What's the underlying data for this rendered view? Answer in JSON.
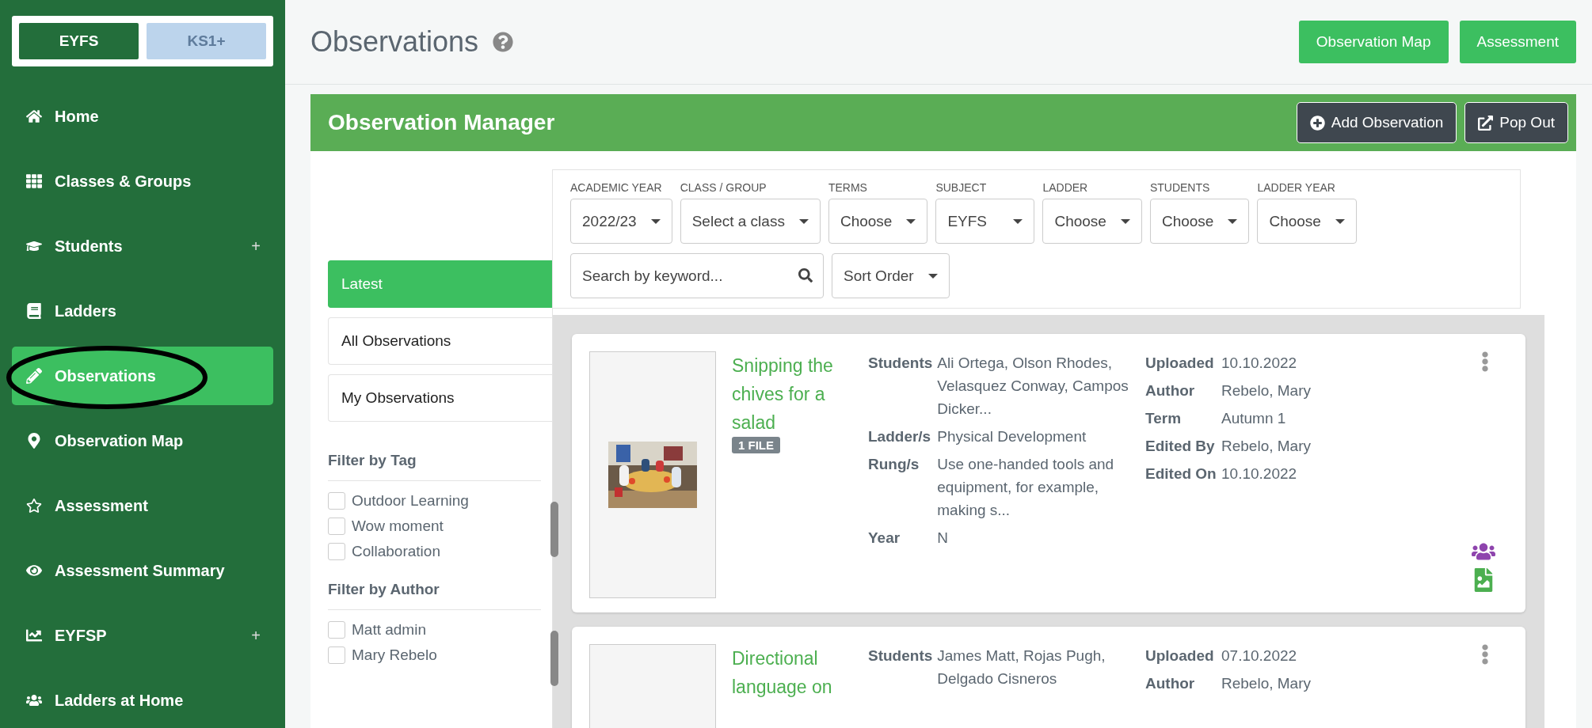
{
  "sidebar": {
    "toggle": [
      {
        "label": "EYFS",
        "selected": true
      },
      {
        "label": "KS1+",
        "selected": false
      }
    ],
    "items": [
      {
        "label": "Home",
        "selected": false
      },
      {
        "label": "Classes & Groups",
        "selected": false
      },
      {
        "label": "Students",
        "selected": false,
        "suffix": "+"
      },
      {
        "label": "Ladders",
        "selected": false
      },
      {
        "label": "Observations",
        "selected": true,
        "circled": true
      },
      {
        "label": "Observation Map",
        "selected": false
      },
      {
        "label": "Assessment",
        "selected": false
      },
      {
        "label": "Assessment Summary",
        "selected": false
      },
      {
        "label": "EYFSP",
        "selected": false,
        "suffix": "+"
      },
      {
        "label": "Ladders at Home",
        "selected": false
      }
    ]
  },
  "header": {
    "title": "Observations",
    "buttons": [
      "Observation Map",
      "Assessment"
    ]
  },
  "panel": {
    "title": "Observation Manager",
    "buttons": [
      "Add Observation",
      "Pop Out"
    ],
    "views": [
      {
        "label": "Latest",
        "selected": true
      },
      {
        "label": "All Observations",
        "selected": false
      },
      {
        "label": "My Observations",
        "selected": false
      }
    ],
    "filter_groups": [
      {
        "title": "Filter by Tag",
        "options": [
          {
            "label": "Outdoor Learning",
            "checked": false
          },
          {
            "label": "Wow moment",
            "checked": false
          },
          {
            "label": "Collaboration",
            "checked": false
          }
        ]
      },
      {
        "title": "Filter by Author",
        "options": [
          {
            "label": "Matt admin",
            "checked": false
          },
          {
            "label": "Mary Rebelo",
            "checked": false
          }
        ]
      }
    ],
    "filters": [
      {
        "label": "ACADEMIC YEAR",
        "value": "2022/23"
      },
      {
        "label": "CLASS / GROUP",
        "value": "Select a class"
      },
      {
        "label": "TERMS",
        "value": "Choose"
      },
      {
        "label": "SUBJECT",
        "value": "EYFS"
      },
      {
        "label": "LADDER",
        "value": "Choose"
      },
      {
        "label": "STUDENTS",
        "value": "Choose"
      },
      {
        "label": "LADDER YEAR",
        "value": "Choose"
      }
    ],
    "search": {
      "placeholder": "Search by keyword..."
    },
    "sort": {
      "value": "Sort Order"
    },
    "observations": [
      {
        "thumbnail": {
          "kind": "picture"
        },
        "title": "Snipping the chives for a salad",
        "badge": "1 FILE",
        "details": [
          {
            "label": "Students",
            "value": "Ali Ortega, Olson Rhodes, Velasquez Conway, Campos Dicker..."
          },
          {
            "label": "Ladder/s",
            "value": "Physical Development"
          },
          {
            "label": "Rung/s",
            "value": "Use one-handed tools and equipment, for example, making s..."
          },
          {
            "label": "Year",
            "value": "N"
          }
        ],
        "meta": [
          {
            "label": "Uploaded",
            "value": "10.10.2022"
          },
          {
            "label": "Author",
            "value": "Rebelo, Mary"
          },
          {
            "label": "Term",
            "value": "Autumn 1"
          },
          {
            "label": "Edited By",
            "value": "Rebelo, Mary"
          },
          {
            "label": "Edited On",
            "value": "10.10.2022"
          }
        ]
      },
      {
        "title": "Directional language on",
        "details": [
          {
            "label": "Students",
            "value": "James Matt, Rojas Pugh, Delgado Cisneros"
          }
        ],
        "meta": [
          {
            "label": "Uploaded",
            "value": "07.10.2022"
          },
          {
            "label": "Author",
            "value": "Rebelo, Mary"
          }
        ]
      }
    ]
  }
}
